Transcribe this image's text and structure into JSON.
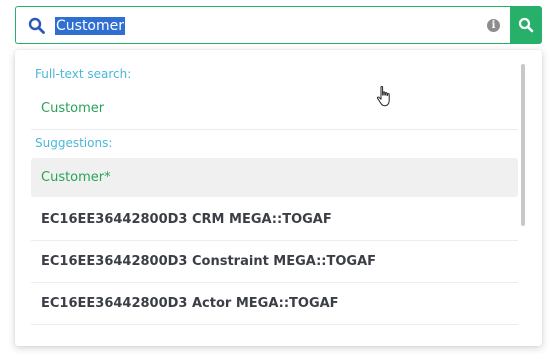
{
  "search": {
    "value": "Customer",
    "info_icon": "info-icon",
    "button_icon": "search-icon"
  },
  "dropdown": {
    "fulltext_label": "Full-text search:",
    "fulltext_item": "Customer",
    "suggestions_label": "Suggestions:",
    "suggestions": [
      "Customer*",
      "EC16EE36442800D3 CRM MEGA::TOGAF",
      "EC16EE36442800D3 Constraint MEGA::TOGAF",
      "EC16EE36442800D3 Actor MEGA::TOGAF",
      ""
    ]
  },
  "colors": {
    "accent": "#27b06a",
    "section_label": "#4ab7d8",
    "selection": "#2f6fd1",
    "item_text": "#3b3f45",
    "active_bg": "#f0f0f0"
  }
}
